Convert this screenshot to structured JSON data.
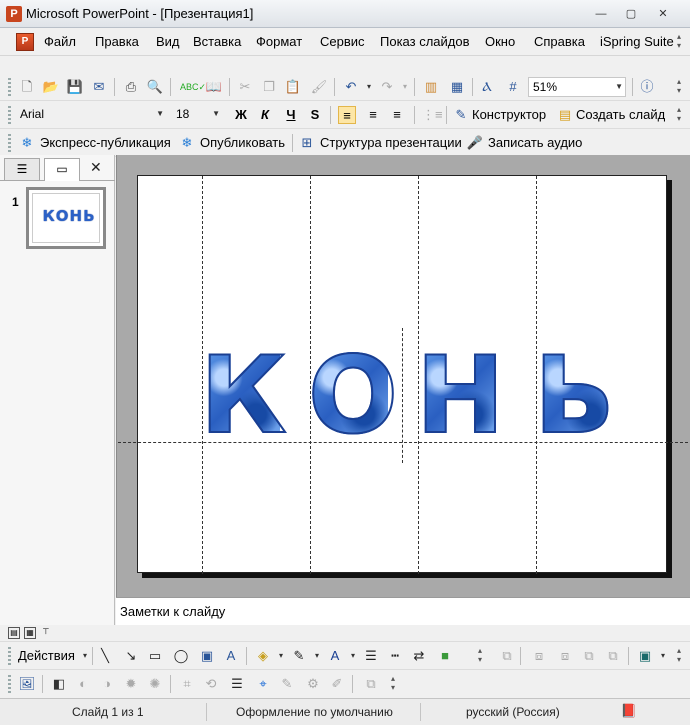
{
  "window": {
    "title": "Microsoft PowerPoint - [Презентация1]",
    "minimize": "—",
    "maximize": "▢",
    "close": "✕"
  },
  "menu": {
    "items": [
      "Файл",
      "Правка",
      "Вид",
      "Вставка",
      "Формат",
      "Сервис",
      "Показ слайдов",
      "Окно",
      "Справка",
      "iSpring Suite"
    ]
  },
  "standard_toolbar": {
    "zoom": "51%"
  },
  "format_toolbar": {
    "font": "Arial",
    "size": "18",
    "bold": "Ж",
    "italic": "К",
    "underline": "Ч",
    "shadow": "S",
    "design_label": "Конструктор",
    "new_slide_label": "Создать слайд"
  },
  "ispring_toolbar": {
    "quick_publish": "Экспресс-публикация",
    "publish": "Опубликовать",
    "structure": "Структура презентации",
    "record_audio": "Записать аудио"
  },
  "left_pane": {
    "slide_number": "1",
    "thumb_text": "КОНЬ",
    "close": "✕"
  },
  "slide": {
    "letters": [
      "К",
      "О",
      "Н",
      "Ь"
    ]
  },
  "notes": {
    "placeholder": "Заметки к слайду"
  },
  "drawing_toolbar": {
    "actions_label": "Действия"
  },
  "status_bar": {
    "slide_info": "Слайд 1 из 1",
    "design": "Оформление по умолчанию",
    "language": "русский (Россия)"
  },
  "colors": {
    "accent": "#2a5fc1",
    "workspace": "#a9a9a9"
  }
}
